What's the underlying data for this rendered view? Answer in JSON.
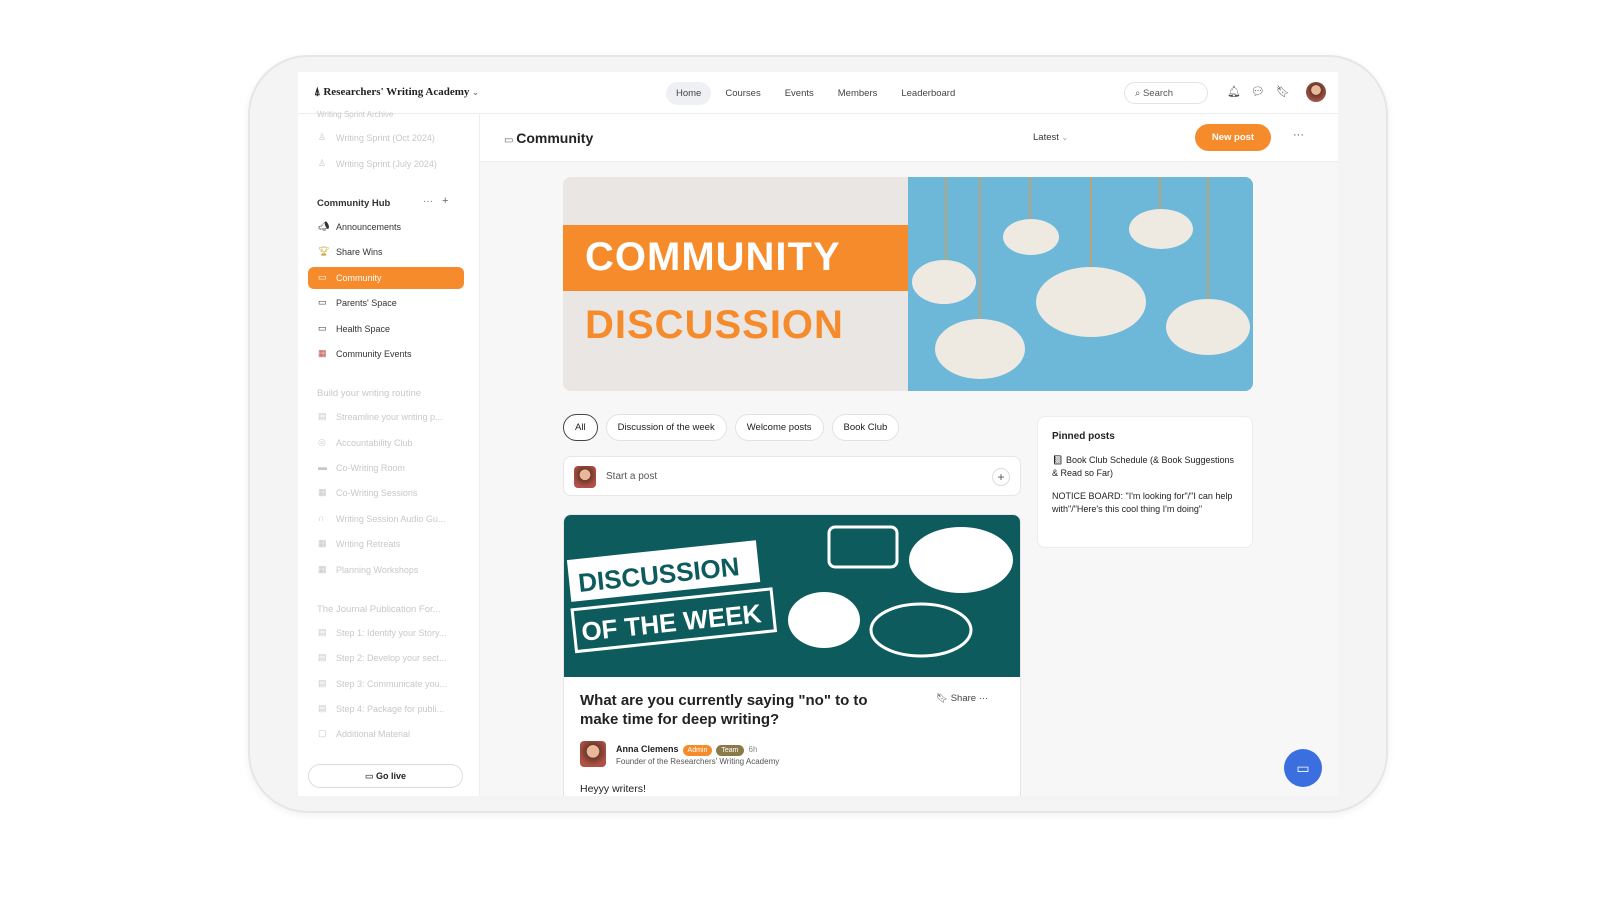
{
  "brand": "Researchers' Writing Academy",
  "nav": [
    "Home",
    "Courses",
    "Events",
    "Members",
    "Leaderboard"
  ],
  "search_placeholder": "Search",
  "sidebar": {
    "archive_heading": "Writing Sprint Archive",
    "archive": [
      "Writing Sprint (Oct 2024)",
      "Writing Sprint (July 2024)"
    ],
    "hub_heading": "Community Hub",
    "hub": [
      "Announcements",
      "Share Wins",
      "Community",
      "Parents' Space",
      "Health Space",
      "Community Events"
    ],
    "routine_heading": "Build your writing routine",
    "routine": [
      "Streamline your writing p...",
      "Accountability Club",
      "Co-Writing Room",
      "Co-Writing Sessions",
      "Writing Session Audio Gu...",
      "Writing Retreats",
      "Planning Workshops"
    ],
    "journal_heading": "The Journal Publication For...",
    "journal": [
      "Step 1: Identify your Story...",
      "Step 2: Develop your sect...",
      "Step 3: Communicate you...",
      "Step 4: Package for publi...",
      "Additional Material"
    ],
    "go_live": "Go live"
  },
  "header": {
    "title": "Community",
    "sort": "Latest",
    "new_post": "New post"
  },
  "banner": {
    "line1": "COMMUNITY",
    "line2": "DISCUSSION"
  },
  "chips": [
    "All",
    "Discussion of the week",
    "Welcome posts",
    "Book Club"
  ],
  "start_post": "Start a post",
  "post": {
    "image_line1": "DISCUSSION",
    "image_line2": "OF THE WEEK",
    "title": "What are you currently saying \"no\" to to make time for deep writing?",
    "share": "Share",
    "author": "Anna Clemens",
    "badge_admin": "Admin",
    "badge_team": "Team",
    "time": "6h",
    "author_sub": "Founder of the Researchers' Writing Academy",
    "body": "Heyyy writers!"
  },
  "pinned": {
    "heading": "Pinned posts",
    "items": [
      "Book Club Schedule (& Book Suggestions & Read so Far)",
      "NOTICE BOARD: \"I'm looking for\"/\"I can help with\"/\"Here's this cool thing I'm doing\""
    ]
  },
  "colors": {
    "accent": "#f68b2c",
    "teal": "#0d5b5d",
    "sky": "#6db8d9",
    "chat_fab": "#3b6fe0"
  }
}
